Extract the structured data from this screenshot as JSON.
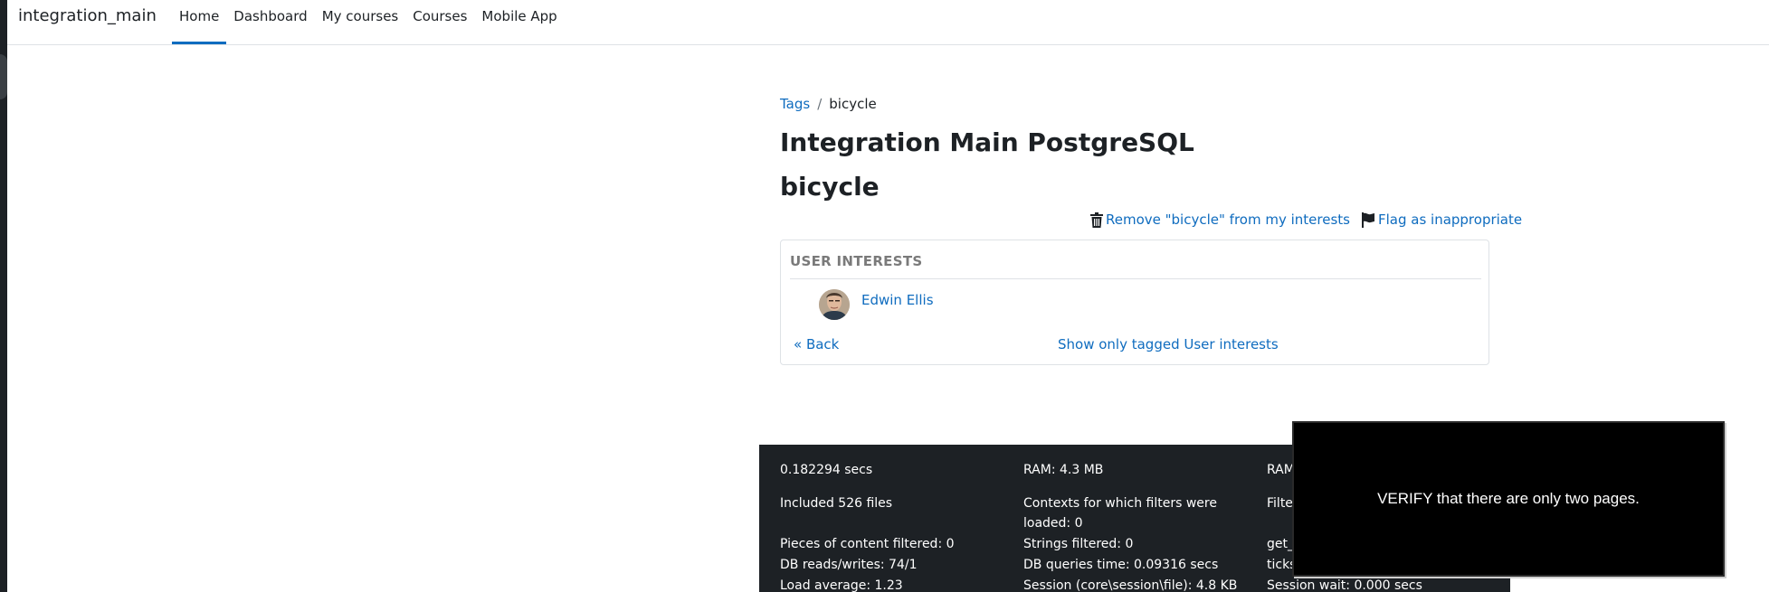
{
  "navbar": {
    "brand": "integration_main",
    "items": [
      {
        "label": "Home",
        "active": true
      },
      {
        "label": "Dashboard",
        "active": false
      },
      {
        "label": "My courses",
        "active": false
      },
      {
        "label": "Courses",
        "active": false
      },
      {
        "label": "Mobile App",
        "active": false
      }
    ]
  },
  "breadcrumb": {
    "root": "Tags",
    "separator": "/",
    "current": "bicycle"
  },
  "page": {
    "title": "Integration Main PostgreSQL",
    "tag": "bicycle"
  },
  "actions": {
    "remove": {
      "label": "Remove \"bicycle\" from my interests",
      "icon": "trash-icon"
    },
    "flag": {
      "label": "Flag as inappropriate",
      "icon": "flag-icon"
    }
  },
  "card": {
    "title": "USER INTERESTS",
    "user": "Edwin Ellis",
    "back": "« Back",
    "show_only": "Show only tagged User interests"
  },
  "footer": {
    "col1": [
      "0.182294 secs",
      "Included 526 files",
      "Pieces of content filtered: 0",
      "DB reads/writes: 74/1",
      "Load average: 1.23"
    ],
    "col2": [
      "RAM: 4.3 MB",
      "Contexts for which filters were",
      "loaded: 0",
      "Strings filtered: 0",
      "DB queries time: 0.09316 secs",
      "Session (core\\session\\file): 4.8 KB"
    ],
    "col3": [
      "RAM",
      "Filte",
      "get_",
      "ticks",
      "Session wait: 0.000 secs"
    ]
  },
  "overlay": {
    "text": "VERIFY that there are only two pages."
  },
  "colors": {
    "link": "#0f6cbf",
    "footer_bg": "#1d2125",
    "overlay_bg": "#000000"
  }
}
